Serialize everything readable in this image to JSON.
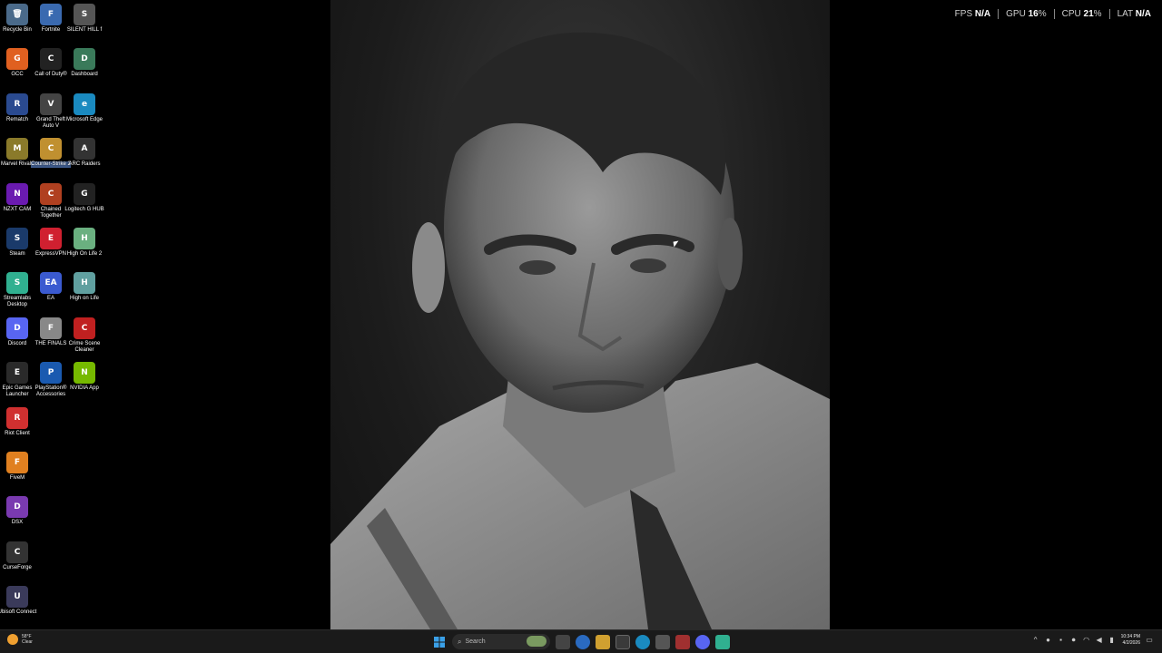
{
  "desktop_icons": [
    {
      "label": "Recycle Bin",
      "glyph": "🗑",
      "color": "#4a6a8a"
    },
    {
      "label": "Fortnite",
      "glyph": "F",
      "color": "#3a6ab0"
    },
    {
      "label": "SILENT HILL f",
      "glyph": "S",
      "color": "#555"
    },
    {
      "label": "GCC",
      "glyph": "G",
      "color": "#e06020"
    },
    {
      "label": "Call of Duty®",
      "glyph": "C",
      "color": "#222"
    },
    {
      "label": "Dashboard",
      "glyph": "D",
      "color": "#3a7a5a"
    },
    {
      "label": "Rematch",
      "glyph": "R",
      "color": "#2a4a90"
    },
    {
      "label": "Grand Theft Auto V",
      "glyph": "V",
      "color": "#444"
    },
    {
      "label": "Microsoft Edge",
      "glyph": "e",
      "color": "#1a8ac0"
    },
    {
      "label": "Marvel Rivals",
      "glyph": "M",
      "color": "#8a7a2a"
    },
    {
      "label": "Counter-Strike 2",
      "glyph": "C",
      "color": "#c09030"
    },
    {
      "label": "ARC Raiders",
      "glyph": "A",
      "color": "#333"
    },
    {
      "label": "NZXT CAM",
      "glyph": "N",
      "color": "#6a1ab0"
    },
    {
      "label": "Chained Together",
      "glyph": "C",
      "color": "#b04020"
    },
    {
      "label": "Logitech G HUB",
      "glyph": "G",
      "color": "#222"
    },
    {
      "label": "Steam",
      "glyph": "S",
      "color": "#1a3a6a"
    },
    {
      "label": "ExpressVPN",
      "glyph": "E",
      "color": "#d02030"
    },
    {
      "label": "High On Life 2",
      "glyph": "H",
      "color": "#6ab080"
    },
    {
      "label": "Streamlabs Desktop",
      "glyph": "S",
      "color": "#30b090"
    },
    {
      "label": "EA",
      "glyph": "EA",
      "color": "#3a5ad0"
    },
    {
      "label": "High on Life",
      "glyph": "H",
      "color": "#60a0a0"
    },
    {
      "label": "Discord",
      "glyph": "D",
      "color": "#5865f2"
    },
    {
      "label": "THE FINALS",
      "glyph": "F",
      "color": "#888"
    },
    {
      "label": "Crime Scene Cleaner",
      "glyph": "C",
      "color": "#c02020"
    },
    {
      "label": "Epic Games Launcher",
      "glyph": "E",
      "color": "#2a2a2a"
    },
    {
      "label": "PlayStation® Accessories",
      "glyph": "P",
      "color": "#1a5ab0"
    },
    {
      "label": "NVIDIA App",
      "glyph": "N",
      "color": "#76b900"
    },
    {
      "label": "Riot Client",
      "glyph": "R",
      "color": "#d03030"
    },
    {
      "label": "FiveM",
      "glyph": "F",
      "color": "#e08020"
    },
    {
      "label": "DSX",
      "glyph": "D",
      "color": "#7a3ab0"
    },
    {
      "label": "CurseForge",
      "glyph": "C",
      "color": "#333"
    },
    {
      "label": "Ubisoft Connect",
      "glyph": "U",
      "color": "#3a3a5a"
    }
  ],
  "overlay": {
    "fps_label": "FPS",
    "fps_value": "N/A",
    "gpu_label": "GPU",
    "gpu_value": "16",
    "cpu_label": "CPU",
    "cpu_value": "21",
    "lat_label": "LAT",
    "lat_value": "N/A",
    "percent": "%"
  },
  "taskbar": {
    "weather_temp": "58°F",
    "weather_desc": "Clear",
    "search_placeholder": "Search",
    "clock_time": "10:34 PM",
    "clock_date": "4/2/2026"
  },
  "colors": {
    "taskbar_bg": "#1a1a1a",
    "start_blue": "#3aa0e8"
  }
}
